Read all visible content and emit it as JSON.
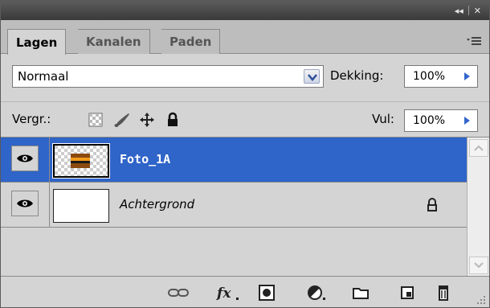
{
  "tabs": [
    {
      "label": "Lagen",
      "active": true
    },
    {
      "label": "Kanalen",
      "active": false
    },
    {
      "label": "Paden",
      "active": false
    }
  ],
  "blend_mode": {
    "selected": "Normaal"
  },
  "opacity": {
    "label": "Dekking:",
    "value": "100%"
  },
  "fill": {
    "label": "Vul:",
    "value": "100%"
  },
  "lock": {
    "label": "Vergr.:"
  },
  "layers": [
    {
      "name": "Foto_1A",
      "visible": true,
      "selected": true,
      "locked": false
    },
    {
      "name": "Achtergrond",
      "visible": true,
      "selected": false,
      "locked": true
    }
  ],
  "colors": {
    "selection": "#2f64c8",
    "panel": "#d4d4d4",
    "titlebar": "#4a4a4a"
  }
}
